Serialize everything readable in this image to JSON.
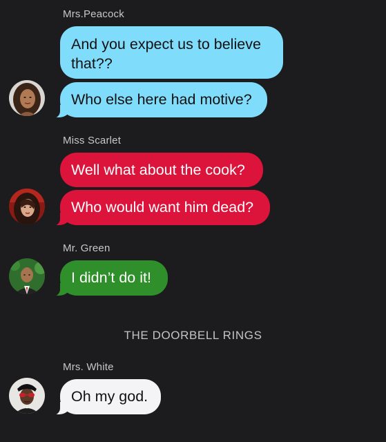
{
  "conversation": [
    {
      "sender": "Mrs.Peacock",
      "avatar": "avatar-mrs-peacock",
      "color": "#80dcfb",
      "messages": [
        "And you expect us to believe\nthat??",
        "Who else here had motive?"
      ]
    },
    {
      "sender": "Miss Scarlet",
      "avatar": "avatar-miss-scarlet",
      "color": "#dc143c",
      "messages": [
        "Well what about the cook?",
        "Who would want him dead?"
      ]
    },
    {
      "sender": "Mr. Green",
      "avatar": "avatar-mr-green",
      "color": "#2f8f2a",
      "messages": [
        "I didn’t do it!"
      ]
    },
    {
      "sender": "Mrs. White",
      "avatar": "avatar-mrs-white",
      "color": "#f4f4f6",
      "messages": [
        "Oh my god."
      ]
    }
  ],
  "narration": "THE DOORBELL RINGS"
}
